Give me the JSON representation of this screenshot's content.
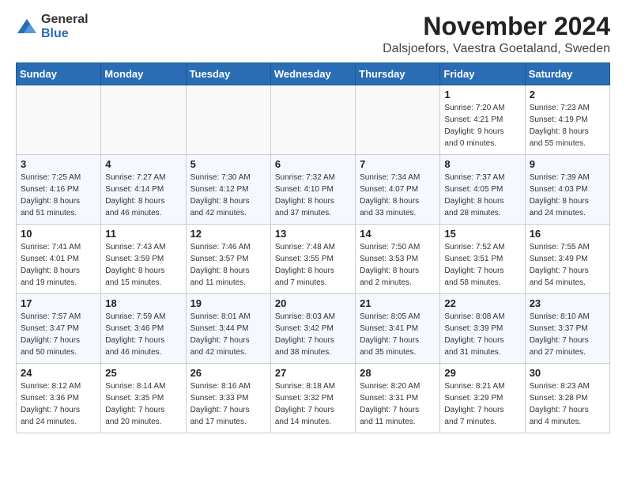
{
  "logo": {
    "general": "General",
    "blue": "Blue"
  },
  "title": "November 2024",
  "location": "Dalsjoefors, Vaestra Goetaland, Sweden",
  "weekdays": [
    "Sunday",
    "Monday",
    "Tuesday",
    "Wednesday",
    "Thursday",
    "Friday",
    "Saturday"
  ],
  "weeks": [
    [
      {
        "day": "",
        "info": ""
      },
      {
        "day": "",
        "info": ""
      },
      {
        "day": "",
        "info": ""
      },
      {
        "day": "",
        "info": ""
      },
      {
        "day": "",
        "info": ""
      },
      {
        "day": "1",
        "info": "Sunrise: 7:20 AM\nSunset: 4:21 PM\nDaylight: 9 hours\nand 0 minutes."
      },
      {
        "day": "2",
        "info": "Sunrise: 7:23 AM\nSunset: 4:19 PM\nDaylight: 8 hours\nand 55 minutes."
      }
    ],
    [
      {
        "day": "3",
        "info": "Sunrise: 7:25 AM\nSunset: 4:16 PM\nDaylight: 8 hours\nand 51 minutes."
      },
      {
        "day": "4",
        "info": "Sunrise: 7:27 AM\nSunset: 4:14 PM\nDaylight: 8 hours\nand 46 minutes."
      },
      {
        "day": "5",
        "info": "Sunrise: 7:30 AM\nSunset: 4:12 PM\nDaylight: 8 hours\nand 42 minutes."
      },
      {
        "day": "6",
        "info": "Sunrise: 7:32 AM\nSunset: 4:10 PM\nDaylight: 8 hours\nand 37 minutes."
      },
      {
        "day": "7",
        "info": "Sunrise: 7:34 AM\nSunset: 4:07 PM\nDaylight: 8 hours\nand 33 minutes."
      },
      {
        "day": "8",
        "info": "Sunrise: 7:37 AM\nSunset: 4:05 PM\nDaylight: 8 hours\nand 28 minutes."
      },
      {
        "day": "9",
        "info": "Sunrise: 7:39 AM\nSunset: 4:03 PM\nDaylight: 8 hours\nand 24 minutes."
      }
    ],
    [
      {
        "day": "10",
        "info": "Sunrise: 7:41 AM\nSunset: 4:01 PM\nDaylight: 8 hours\nand 19 minutes."
      },
      {
        "day": "11",
        "info": "Sunrise: 7:43 AM\nSunset: 3:59 PM\nDaylight: 8 hours\nand 15 minutes."
      },
      {
        "day": "12",
        "info": "Sunrise: 7:46 AM\nSunset: 3:57 PM\nDaylight: 8 hours\nand 11 minutes."
      },
      {
        "day": "13",
        "info": "Sunrise: 7:48 AM\nSunset: 3:55 PM\nDaylight: 8 hours\nand 7 minutes."
      },
      {
        "day": "14",
        "info": "Sunrise: 7:50 AM\nSunset: 3:53 PM\nDaylight: 8 hours\nand 2 minutes."
      },
      {
        "day": "15",
        "info": "Sunrise: 7:52 AM\nSunset: 3:51 PM\nDaylight: 7 hours\nand 58 minutes."
      },
      {
        "day": "16",
        "info": "Sunrise: 7:55 AM\nSunset: 3:49 PM\nDaylight: 7 hours\nand 54 minutes."
      }
    ],
    [
      {
        "day": "17",
        "info": "Sunrise: 7:57 AM\nSunset: 3:47 PM\nDaylight: 7 hours\nand 50 minutes."
      },
      {
        "day": "18",
        "info": "Sunrise: 7:59 AM\nSunset: 3:46 PM\nDaylight: 7 hours\nand 46 minutes."
      },
      {
        "day": "19",
        "info": "Sunrise: 8:01 AM\nSunset: 3:44 PM\nDaylight: 7 hours\nand 42 minutes."
      },
      {
        "day": "20",
        "info": "Sunrise: 8:03 AM\nSunset: 3:42 PM\nDaylight: 7 hours\nand 38 minutes."
      },
      {
        "day": "21",
        "info": "Sunrise: 8:05 AM\nSunset: 3:41 PM\nDaylight: 7 hours\nand 35 minutes."
      },
      {
        "day": "22",
        "info": "Sunrise: 8:08 AM\nSunset: 3:39 PM\nDaylight: 7 hours\nand 31 minutes."
      },
      {
        "day": "23",
        "info": "Sunrise: 8:10 AM\nSunset: 3:37 PM\nDaylight: 7 hours\nand 27 minutes."
      }
    ],
    [
      {
        "day": "24",
        "info": "Sunrise: 8:12 AM\nSunset: 3:36 PM\nDaylight: 7 hours\nand 24 minutes."
      },
      {
        "day": "25",
        "info": "Sunrise: 8:14 AM\nSunset: 3:35 PM\nDaylight: 7 hours\nand 20 minutes."
      },
      {
        "day": "26",
        "info": "Sunrise: 8:16 AM\nSunset: 3:33 PM\nDaylight: 7 hours\nand 17 minutes."
      },
      {
        "day": "27",
        "info": "Sunrise: 8:18 AM\nSunset: 3:32 PM\nDaylight: 7 hours\nand 14 minutes."
      },
      {
        "day": "28",
        "info": "Sunrise: 8:20 AM\nSunset: 3:31 PM\nDaylight: 7 hours\nand 11 minutes."
      },
      {
        "day": "29",
        "info": "Sunrise: 8:21 AM\nSunset: 3:29 PM\nDaylight: 7 hours\nand 7 minutes."
      },
      {
        "day": "30",
        "info": "Sunrise: 8:23 AM\nSunset: 3:28 PM\nDaylight: 7 hours\nand 4 minutes."
      }
    ]
  ]
}
